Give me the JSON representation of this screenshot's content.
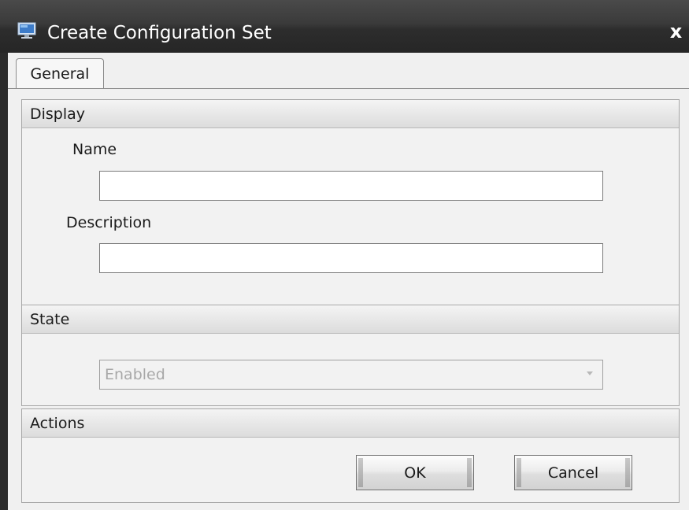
{
  "window": {
    "title": "Create Configuration Set",
    "close_glyph": "x",
    "icon": "monitor-icon"
  },
  "tabs": [
    {
      "label": "General",
      "selected": true
    }
  ],
  "display": {
    "header": "Display",
    "name_label": "Name",
    "name_value": "",
    "description_label": "Description",
    "description_value": ""
  },
  "state": {
    "header": "State",
    "selected": "Enabled",
    "enabled": false
  },
  "actions": {
    "header": "Actions",
    "ok_label": "OK",
    "cancel_label": "Cancel"
  },
  "colors": {
    "titlebar": "#2d2d2d",
    "panel": "#f0f0f0",
    "border": "#a8a8a8"
  }
}
